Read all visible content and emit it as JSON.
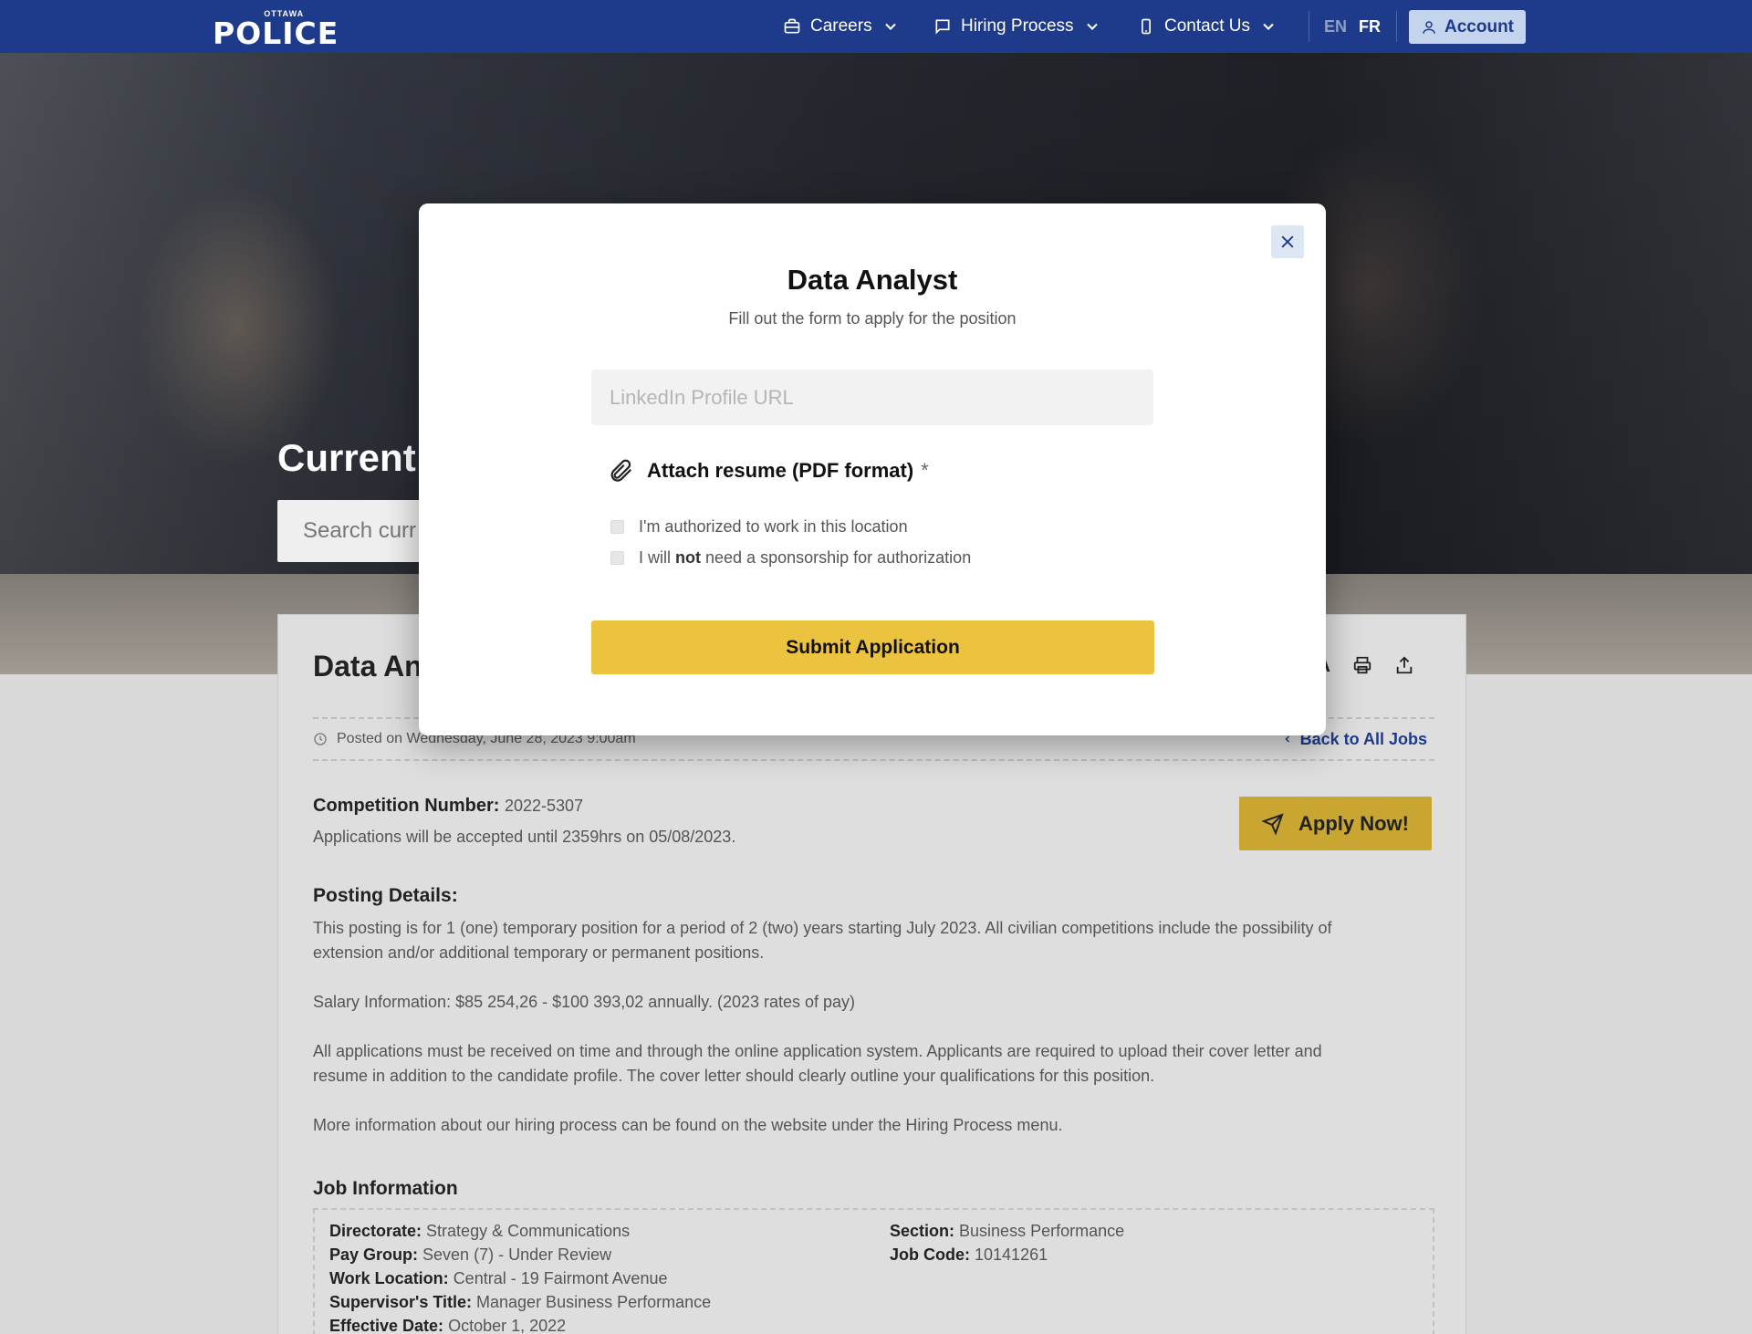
{
  "nav": {
    "logo_small": "OTTAWA",
    "logo_big": "POLICE",
    "items": [
      {
        "label": "Careers",
        "icon": "briefcase-icon"
      },
      {
        "label": "Hiring Process",
        "icon": "chat-icon"
      },
      {
        "label": "Contact Us",
        "icon": "phone-icon"
      }
    ],
    "lang_en": "EN",
    "lang_fr": "FR",
    "account": "Account",
    "bg_color": "#1e3a8a"
  },
  "hero": {
    "title": "Current",
    "search_placeholder": "Search curr"
  },
  "job": {
    "title": "Data An",
    "tool_text": "A",
    "posted": "Posted on Wednesday, June 28, 2023 9:00am",
    "back": "Back to All Jobs",
    "competition_label": "Competition Number:",
    "competition_value": "2022-5307",
    "accept": "Applications will be accepted until 2359hrs on 05/08/2023.",
    "apply": "Apply Now!",
    "posting_heading": "Posting Details:",
    "p1": "This posting is for 1 (one) temporary position for a period of 2 (two) years starting July 2023. All civilian competitions include the possibility of extension and/or additional temporary or permanent positions.",
    "p2": "Salary Information: $85 254,26 - $100 393,02 annually. (2023 rates of pay)",
    "p3": "All applications must be received on time and through the online application system. Applicants are required to upload their cover letter and resume in addition to the candidate profile. The cover letter should clearly outline your qualifications for this position.",
    "p4": "More information about our hiring process can be found on the website under the Hiring Process menu.",
    "info_heading": "Job Information",
    "info_left": [
      {
        "label": "Directorate:",
        "value": "Strategy & Communications"
      },
      {
        "label": "Pay Group:",
        "value": "Seven (7) - Under Review"
      },
      {
        "label": "Work Location:",
        "value": "Central - 19 Fairmont Avenue"
      },
      {
        "label": "Supervisor's Title:",
        "value": "Manager Business Performance"
      },
      {
        "label": "Effective Date:",
        "value": "October 1, 2022"
      }
    ],
    "info_right": [
      {
        "label": "Section:",
        "value": "Business Performance"
      },
      {
        "label": "Job Code:",
        "value": "10141261"
      }
    ]
  },
  "modal": {
    "title": "Data Analyst",
    "subtitle": "Fill out the form to apply for the position",
    "linkedin_placeholder": "LinkedIn Profile URL",
    "attach_label": "Attach resume (PDF format)",
    "attach_required": "*",
    "check1": "I'm authorized to work in this location",
    "check2_pre": "I will",
    "check2_bold": "not",
    "check2_post": "need a sponsorship for authorization",
    "submit": "Submit Application",
    "submit_color": "#ecc33f"
  }
}
